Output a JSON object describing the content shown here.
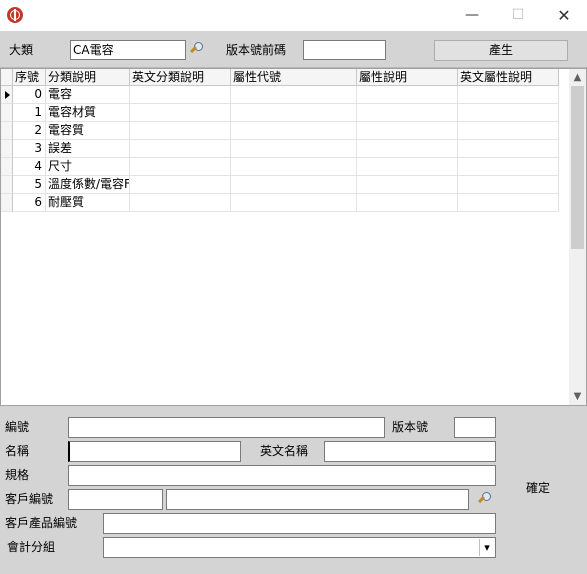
{
  "window": {
    "minimize": "—",
    "maximize": "☐",
    "close": "✕"
  },
  "filter": {
    "category_label": "大類",
    "category_value": "CA電容",
    "version_prefix_label": "版本號前碼",
    "version_prefix_value": "",
    "generate_button": "產生"
  },
  "grid": {
    "columns": [
      "序號",
      "分類說明",
      "英文分類說明",
      "屬性代號",
      "屬性說明",
      "英文屬性說明"
    ],
    "rows": [
      {
        "seq": "0",
        "desc": "電容",
        "en_desc": "",
        "attr_code": "",
        "attr_desc": "",
        "en_attr_desc": ""
      },
      {
        "seq": "1",
        "desc": "電容材質",
        "en_desc": "",
        "attr_code": "",
        "attr_desc": "",
        "en_attr_desc": ""
      },
      {
        "seq": "2",
        "desc": "電容質",
        "en_desc": "",
        "attr_code": "",
        "attr_desc": "",
        "en_attr_desc": ""
      },
      {
        "seq": "3",
        "desc": "誤差",
        "en_desc": "",
        "attr_code": "",
        "attr_desc": "",
        "en_attr_desc": ""
      },
      {
        "seq": "4",
        "desc": "尺寸",
        "en_desc": "",
        "attr_code": "",
        "attr_desc": "",
        "en_attr_desc": ""
      },
      {
        "seq": "5",
        "desc": "溫度係數/電容F",
        "en_desc": "",
        "attr_code": "",
        "attr_desc": "",
        "en_attr_desc": ""
      },
      {
        "seq": "6",
        "desc": "耐壓質",
        "en_desc": "",
        "attr_code": "",
        "attr_desc": "",
        "en_attr_desc": ""
      }
    ],
    "scroll_up": "▲",
    "scroll_down": "▼"
  },
  "form": {
    "code_label": "編號",
    "code_value": "",
    "version_label": "版本號",
    "version_value": "",
    "name_label": "名稱",
    "name_value": "",
    "en_name_label": "英文名稱",
    "en_name_value": "",
    "spec_label": "規格",
    "spec_value": "",
    "customer_code_label": "客戶編號",
    "customer_code_value": "",
    "customer_name_value": "",
    "customer_product_label": "客戶產品編號",
    "customer_product_value": "",
    "account_group_label": "會計分組",
    "account_group_value": "",
    "dropdown_arrow": "▾",
    "confirm_button": "確定"
  }
}
